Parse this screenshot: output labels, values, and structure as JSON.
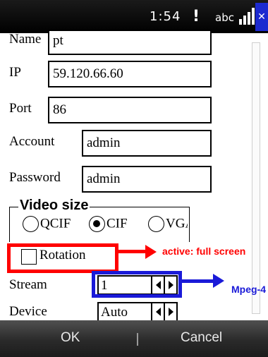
{
  "status_bar": {
    "clock": "1:54",
    "wifi_glyph": "!",
    "input_mode": "abc",
    "icons": [
      "wifi-icon",
      "signal-strength-icon",
      "close-icon"
    ]
  },
  "form": {
    "name_label": "Name",
    "name_value": "pt",
    "ip_label": "IP",
    "ip_value": "59.120.66.60",
    "port_label": "Port",
    "port_value": "86",
    "account_label": "Account",
    "account_value": "admin",
    "password_label": "Password",
    "password_value": "admin",
    "video_size_title": "Video size",
    "video_sizes": [
      {
        "label": "QCIF",
        "selected": false
      },
      {
        "label": "CIF",
        "selected": true
      },
      {
        "label": "VGA",
        "selected": false
      }
    ],
    "rotation_label": "Rotation",
    "rotation_checked": false,
    "stream_label": "Stream",
    "stream_value": "1",
    "device_label": "Device",
    "device_value": "Auto"
  },
  "annotations": {
    "red_note": "active: full screen",
    "blue_note": "Mpeg-4",
    "red_color": "#ff0000",
    "blue_color": "#1a1ad8"
  },
  "softkeys": {
    "left": "OK",
    "right": "Cancel"
  }
}
